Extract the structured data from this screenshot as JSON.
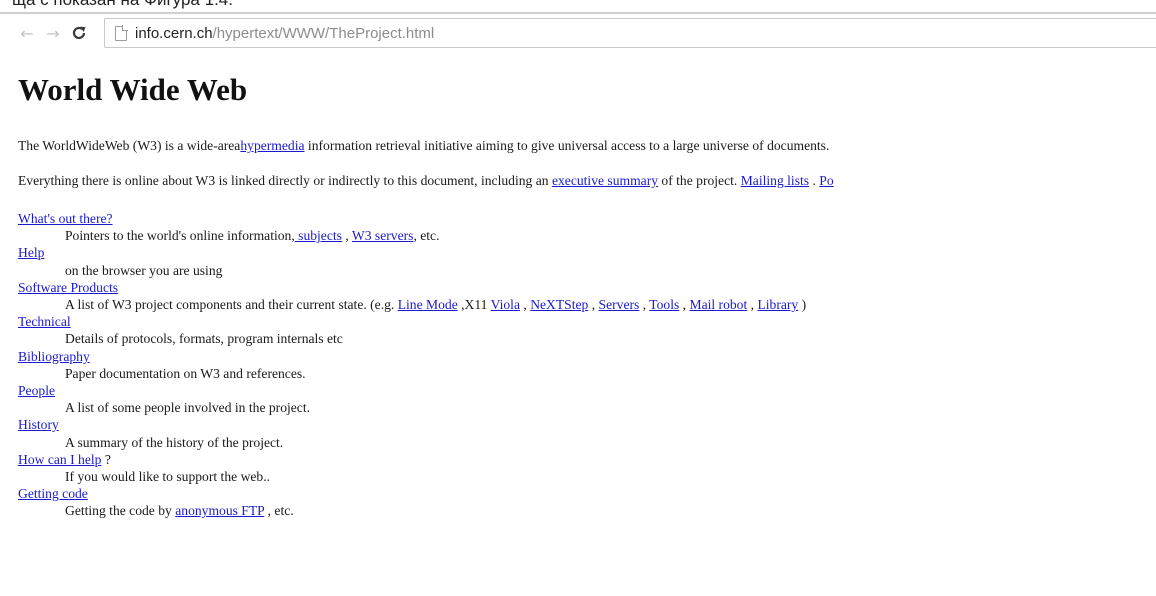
{
  "caption": "ща с показан на Фигура 1.4.",
  "browser": {
    "back_icon": "back-arrow-icon",
    "forward_icon": "forward-arrow-icon",
    "reload_icon": "reload-icon",
    "page_icon": "page-document-icon",
    "url_host": "info.cern.ch",
    "url_path": "/hypertext/WWW/TheProject.html"
  },
  "page": {
    "title": "World Wide Web",
    "intro": {
      "before": "The WorldWideWeb (W3) is a wide-area",
      "link": "hypermedia",
      "after": " information retrieval initiative aiming to give universal access to a large universe of documents."
    },
    "everything": {
      "before": "Everything there is online about W3 is linked directly or indirectly to this document, including an ",
      "link1": "executive summary",
      "middle": " of the project. ",
      "link2": "Mailing lists",
      "sep": " . ",
      "link3": "Po"
    },
    "topics": [
      {
        "title": "What's out there?",
        "desc_before": "Pointers to the world's online information,",
        "link1": " subjects",
        "sep1": " , ",
        "link2": "W3 servers",
        "desc_after": ", etc."
      },
      {
        "title": "Help",
        "desc": "on the browser you are using"
      },
      {
        "title": "Software Products",
        "desc_before": "A list of W3 project components and their current state. (e.g. ",
        "links": [
          "Line Mode",
          "Viola",
          "NeXTStep",
          "Servers",
          "Tools",
          " Mail robot",
          " Library"
        ],
        "text_x11": " ,X11 ",
        "sep": " , ",
        "desc_after": " )"
      },
      {
        "title": "Technical",
        "desc": "Details of protocols, formats, program internals etc"
      },
      {
        "title": "Bibliography",
        "desc": "Paper documentation on W3 and references."
      },
      {
        "title": "People",
        "desc": "A list of some people involved in the project."
      },
      {
        "title": "History",
        "desc": "A summary of the history of the project."
      },
      {
        "title": "How can I help",
        "title_after": " ?",
        "desc": "If you would like to support the web.."
      },
      {
        "title": "Getting code",
        "desc_before": "Getting the code by ",
        "link": "anonymous FTP",
        "desc_after": " , etc."
      }
    ]
  }
}
